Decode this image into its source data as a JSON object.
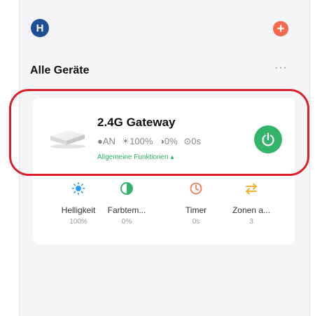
{
  "header": {
    "logo_text": "H"
  },
  "page_title": "Alle Geräte",
  "more_label": "···",
  "add_label": "+",
  "device": {
    "name": "2.4G Gateway",
    "status": {
      "power": "●AN",
      "brightness": "☀100%",
      "temperature": "◑0%",
      "timer": "⊙0s"
    },
    "functions_label": "Allgemeine Funktionen ▴"
  },
  "functions": [
    {
      "label": "Helligkeit",
      "value": "100%",
      "icon": "brightness-icon",
      "color": "#2f9cf0"
    },
    {
      "label": "Farbtem...",
      "value": "0%",
      "icon": "color-temperature-icon",
      "color": "#34b36a"
    },
    {
      "label": "Timer",
      "value": "0s",
      "icon": "timer-icon",
      "color": "#f07a5a"
    },
    {
      "label": "Zonen a...",
      "value": "3",
      "icon": "zones-icon",
      "color": "#f2b233"
    }
  ],
  "colors": {
    "accent_green": "#34b36a",
    "highlight_red": "#d9202a",
    "add_orange": "#f26a4b",
    "logo_blue": "#1f4e96"
  }
}
